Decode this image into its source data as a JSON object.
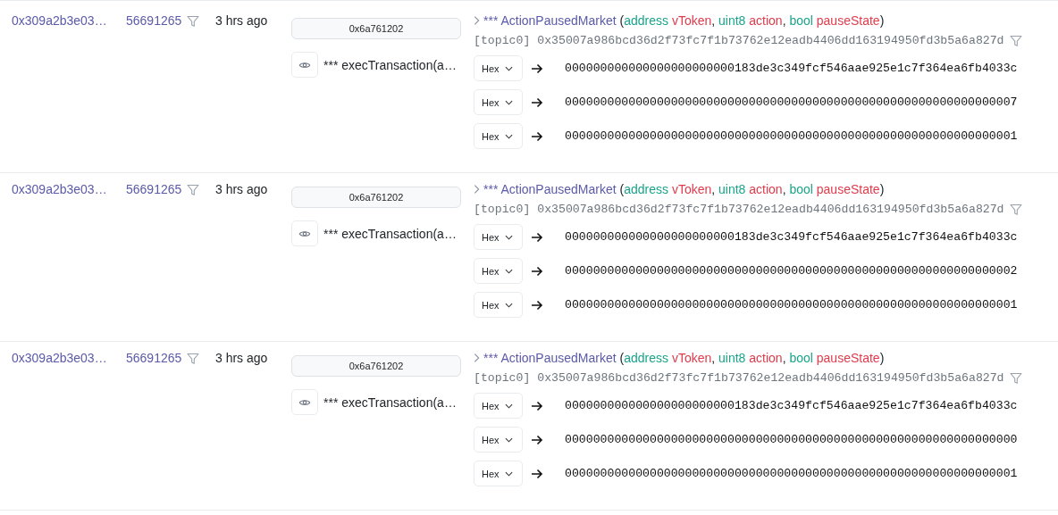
{
  "rows": [
    {
      "tx_hash": "0x309a2b3e03…",
      "block": "56691265",
      "age": "3 hrs ago",
      "method_id": "0x6a761202",
      "method_call": "*** execTransaction(a…",
      "event": {
        "name": "*** ActionPausedMarket",
        "open": "(",
        "close": ")",
        "separator": ",",
        "params": [
          {
            "type": "address",
            "name": "vToken"
          },
          {
            "type": "uint8",
            "name": "action"
          },
          {
            "type": "bool",
            "name": "pauseState"
          }
        ]
      },
      "topic_label": "[topic0]",
      "topic": "0x35007a986bcd36d2f73fc7f1b73762e12eadb4406dd163194950fd3b5a6a827d",
      "data": [
        {
          "format": "Hex",
          "value": "000000000000000000000000183de3c349fcf546aae925e1c7f364ea6fb4033c"
        },
        {
          "format": "Hex",
          "value": "0000000000000000000000000000000000000000000000000000000000000007"
        },
        {
          "format": "Hex",
          "value": "0000000000000000000000000000000000000000000000000000000000000001"
        }
      ]
    },
    {
      "tx_hash": "0x309a2b3e03…",
      "block": "56691265",
      "age": "3 hrs ago",
      "method_id": "0x6a761202",
      "method_call": "*** execTransaction(a…",
      "event": {
        "name": "*** ActionPausedMarket",
        "open": "(",
        "close": ")",
        "separator": ",",
        "params": [
          {
            "type": "address",
            "name": "vToken"
          },
          {
            "type": "uint8",
            "name": "action"
          },
          {
            "type": "bool",
            "name": "pauseState"
          }
        ]
      },
      "topic_label": "[topic0]",
      "topic": "0x35007a986bcd36d2f73fc7f1b73762e12eadb4406dd163194950fd3b5a6a827d",
      "data": [
        {
          "format": "Hex",
          "value": "000000000000000000000000183de3c349fcf546aae925e1c7f364ea6fb4033c"
        },
        {
          "format": "Hex",
          "value": "0000000000000000000000000000000000000000000000000000000000000002"
        },
        {
          "format": "Hex",
          "value": "0000000000000000000000000000000000000000000000000000000000000001"
        }
      ]
    },
    {
      "tx_hash": "0x309a2b3e03…",
      "block": "56691265",
      "age": "3 hrs ago",
      "method_id": "0x6a761202",
      "method_call": "*** execTransaction(a…",
      "event": {
        "name": "*** ActionPausedMarket",
        "open": "(",
        "close": ")",
        "separator": ",",
        "params": [
          {
            "type": "address",
            "name": "vToken"
          },
          {
            "type": "uint8",
            "name": "action"
          },
          {
            "type": "bool",
            "name": "pauseState"
          }
        ]
      },
      "topic_label": "[topic0]",
      "topic": "0x35007a986bcd36d2f73fc7f1b73762e12eadb4406dd163194950fd3b5a6a827d",
      "data": [
        {
          "format": "Hex",
          "value": "000000000000000000000000183de3c349fcf546aae925e1c7f364ea6fb4033c"
        },
        {
          "format": "Hex",
          "value": "0000000000000000000000000000000000000000000000000000000000000000"
        },
        {
          "format": "Hex",
          "value": "0000000000000000000000000000000000000000000000000000000000000001"
        }
      ]
    }
  ]
}
